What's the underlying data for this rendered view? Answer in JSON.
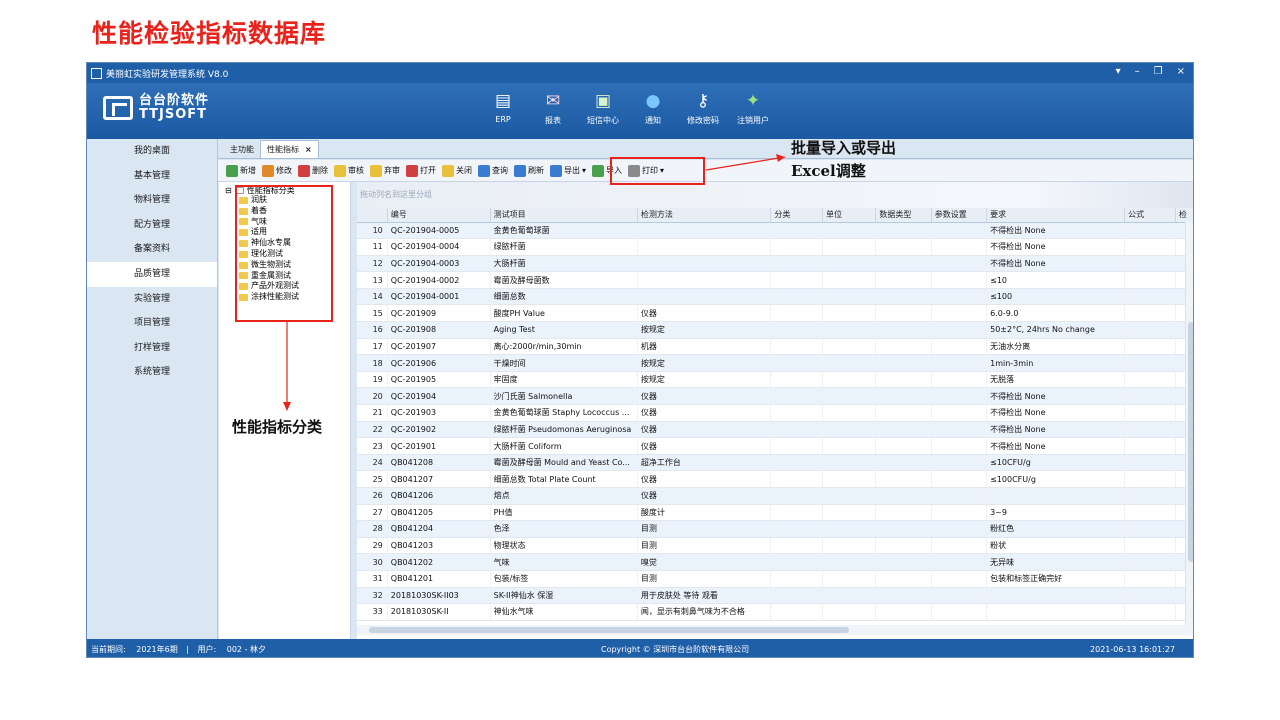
{
  "slide_title": "性能检验指标数据库",
  "app": {
    "window_title": "美丽虹实验研发管理系统 V8.0",
    "window_controls": [
      "▾",
      "–",
      "❐",
      "×"
    ],
    "logo_line1": "台台阶软件",
    "logo_line2": "TTJSOFT",
    "topnav": [
      {
        "label": "ERP",
        "icon": "erp-icon",
        "glyph": "▤",
        "color": "#ffffff"
      },
      {
        "label": "报表",
        "icon": "report-icon",
        "glyph": "✉",
        "color": "#ffd6e6"
      },
      {
        "label": "短信中心",
        "icon": "sms-icon",
        "glyph": "▣",
        "color": "#d9f2c7"
      },
      {
        "label": "通知",
        "icon": "notice-icon",
        "glyph": "●",
        "color": "#7cc6ff"
      },
      {
        "label": "修改密码",
        "icon": "key-icon",
        "glyph": "⚷",
        "color": "#ffffff"
      },
      {
        "label": "注销用户",
        "icon": "users-icon",
        "glyph": "✦",
        "color": "#9be27a"
      }
    ],
    "sidebar": [
      {
        "label": "我的桌面",
        "active": false
      },
      {
        "label": "基本管理",
        "active": false
      },
      {
        "label": "物料管理",
        "active": false
      },
      {
        "label": "配方管理",
        "active": false
      },
      {
        "label": "备案资料",
        "active": false
      },
      {
        "label": "品质管理",
        "active": true
      },
      {
        "label": "实验管理",
        "active": false
      },
      {
        "label": "项目管理",
        "active": false
      },
      {
        "label": "打样管理",
        "active": false
      },
      {
        "label": "系统管理",
        "active": false
      }
    ],
    "tabs": [
      {
        "label": "主功能",
        "active": false
      },
      {
        "label": "性能指标",
        "active": true,
        "close": "×"
      }
    ],
    "toolbar": [
      {
        "label": "新增",
        "icon": "new-icon",
        "color": "green"
      },
      {
        "label": "修改",
        "icon": "edit-icon",
        "color": "orange"
      },
      {
        "label": "删除",
        "icon": "delete-icon",
        "color": "red"
      },
      {
        "label": "审核",
        "icon": "approve-icon",
        "color": "yellow"
      },
      {
        "label": "弃审",
        "icon": "unapprove-icon",
        "color": "yellow"
      },
      {
        "label": "打开",
        "icon": "unlock-icon",
        "color": "red"
      },
      {
        "label": "关闭",
        "icon": "lock-icon",
        "color": "yellow"
      },
      {
        "label": "查询",
        "icon": "search-icon",
        "color": "blue"
      },
      {
        "label": "刷新",
        "icon": "refresh-icon",
        "color": "blue"
      },
      {
        "label": "导出",
        "icon": "export-icon",
        "color": "blue",
        "dropdown": "▾"
      },
      {
        "label": "导入",
        "icon": "import-icon",
        "color": "green"
      },
      {
        "label": "打印",
        "icon": "print-icon",
        "color": "gray",
        "dropdown": "▾"
      }
    ],
    "tree": {
      "root": "性能指标分类",
      "expander": "⊟",
      "children": [
        "润肤",
        "着香",
        "气味",
        "适用",
        "神仙水专属",
        "理化测试",
        "微生物测试",
        "重金属测试",
        "产品外观测试",
        "涂抹性能测试"
      ]
    },
    "grid": {
      "group_hint": "拖动列名到这里分组",
      "columns": [
        "",
        "编号",
        "测试项目",
        "检测方法",
        "分类",
        "单位",
        "数据类型",
        "参数设置",
        "要求",
        "公式",
        "检"
      ],
      "rows": [
        [
          "10",
          "QC-201904-0005",
          "金黄色葡萄球菌",
          "",
          "",
          "",
          "",
          "",
          "不得检出 None",
          ""
        ],
        [
          "11",
          "QC-201904-0004",
          "绿脓杆菌",
          "",
          "",
          "",
          "",
          "",
          "不得检出 None",
          ""
        ],
        [
          "12",
          "QC-201904-0003",
          "大肠杆菌",
          "",
          "",
          "",
          "",
          "",
          "不得检出 None",
          ""
        ],
        [
          "13",
          "QC-201904-0002",
          "霉菌及酵母菌数",
          "",
          "",
          "",
          "",
          "",
          "≤10",
          ""
        ],
        [
          "14",
          "QC-201904-0001",
          "细菌总数",
          "",
          "",
          "",
          "",
          "",
          "≤100",
          ""
        ],
        [
          "15",
          "QC-201909",
          "酸度PH Value",
          "仪器",
          "",
          "",
          "",
          "",
          "6.0-9.0",
          ""
        ],
        [
          "16",
          "QC-201908",
          "Aging Test",
          "按规定",
          "",
          "",
          "",
          "",
          "50±2°C, 24hrs No change",
          ""
        ],
        [
          "17",
          "QC-201907",
          "离心:2000r/min,30min",
          "机器",
          "",
          "",
          "",
          "",
          "无油水分离",
          ""
        ],
        [
          "18",
          "QC-201906",
          "干燥时间",
          "按规定",
          "",
          "",
          "",
          "",
          "1min-3min",
          ""
        ],
        [
          "19",
          "QC-201905",
          "牢固度",
          "按规定",
          "",
          "",
          "",
          "",
          "无脱落",
          ""
        ],
        [
          "20",
          "QC-201904",
          "沙门氏菌 Salmonella",
          "仪器",
          "",
          "",
          "",
          "",
          "不得检出 None",
          ""
        ],
        [
          "21",
          "QC-201903",
          "金黄色葡萄球菌 Staphy Lococcus ...",
          "仪器",
          "",
          "",
          "",
          "",
          "不得检出 None",
          ""
        ],
        [
          "22",
          "QC-201902",
          "绿脓杆菌 Pseudomonas Aeruginosa",
          "仪器",
          "",
          "",
          "",
          "",
          "不得检出 None",
          ""
        ],
        [
          "23",
          "QC-201901",
          "大肠杆菌 Coliform",
          "仪器",
          "",
          "",
          "",
          "",
          "不得检出 None",
          ""
        ],
        [
          "24",
          "QB041208",
          "霉菌及酵母菌 Mould and Yeast Co...",
          "超净工作台",
          "",
          "",
          "",
          "",
          "≤10CFU/g",
          ""
        ],
        [
          "25",
          "QB041207",
          "细菌总数 Total Plate Count",
          "仪器",
          "",
          "",
          "",
          "",
          "≤100CFU/g",
          ""
        ],
        [
          "26",
          "QB041206",
          "熔点",
          "仪器",
          "",
          "",
          "",
          "",
          "",
          ""
        ],
        [
          "27",
          "QB041205",
          "PH值",
          "酸度计",
          "",
          "",
          "",
          "",
          "3~9",
          ""
        ],
        [
          "28",
          "QB041204",
          "色泽",
          "目测",
          "",
          "",
          "",
          "",
          "粉红色",
          ""
        ],
        [
          "29",
          "QB041203",
          "物理状态",
          "目测",
          "",
          "",
          "",
          "",
          "粉状",
          ""
        ],
        [
          "30",
          "QB041202",
          "气味",
          "嗅觉",
          "",
          "",
          "",
          "",
          "无异味",
          ""
        ],
        [
          "31",
          "QB041201",
          "包装/标签",
          "目测",
          "",
          "",
          "",
          "",
          "包装和标签正确完好",
          ""
        ],
        [
          "32",
          "20181030SK-II03",
          "SK-II神仙水 保湿",
          "用于皮肤处 等待 观看",
          "",
          "",
          "",
          "",
          "",
          ""
        ],
        [
          "33",
          "20181030SK-II",
          "神仙水气味",
          "闻，显示有刺鼻气味为不合格",
          "",
          "",
          "",
          "",
          "",
          ""
        ]
      ]
    },
    "status": {
      "period_label": "当前期间:",
      "period": "2021年6期",
      "user_label": "用户:",
      "user": "002 - 林夕",
      "copyright": "Copyright © 深圳市台台阶软件有限公司",
      "datetime": "2021-06-13 16:01:27"
    }
  },
  "annotations": {
    "import_export_line1": "批量导入或导出",
    "import_export_line2": "Excel调整",
    "category_note": "性能指标分类"
  }
}
